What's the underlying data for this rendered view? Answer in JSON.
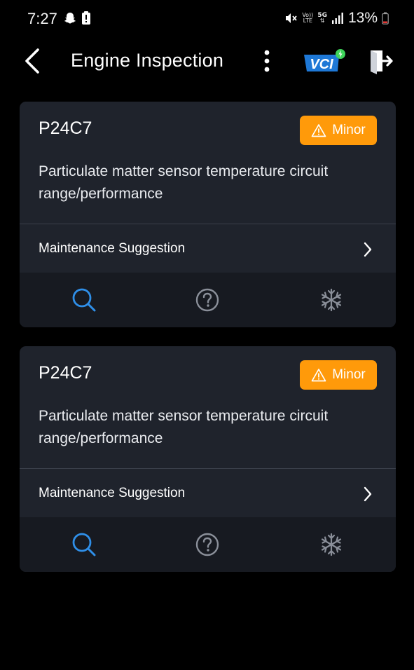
{
  "status_bar": {
    "time": "7:27",
    "battery": "13%",
    "volte_top": "Vo))",
    "volte_bottom": "LTE",
    "network_label": "5G"
  },
  "header": {
    "title": "Engine Inspection",
    "vci_label": "VCI"
  },
  "colors": {
    "background": "#000000",
    "card": "#1f232c",
    "card_actions": "#171a21",
    "severity_minor": "#ff9a0a",
    "accent_blue": "#2f8fe8",
    "vci_blue": "#1e78d6",
    "vci_dot": "#3ed45a",
    "muted_icon": "#8a8f99"
  },
  "dtc_cards": [
    {
      "code": "P24C7",
      "severity": "Minor",
      "description": "Particulate matter sensor temperature circuit range/performance",
      "suggestion_label": "Maintenance Suggestion",
      "actions": [
        "search-icon",
        "help-icon",
        "freeze-frame-icon"
      ]
    },
    {
      "code": "P24C7",
      "severity": "Minor",
      "description": "Particulate matter sensor temperature circuit range/performance",
      "suggestion_label": "Maintenance Suggestion",
      "actions": [
        "search-icon",
        "help-icon",
        "freeze-frame-icon"
      ]
    }
  ]
}
